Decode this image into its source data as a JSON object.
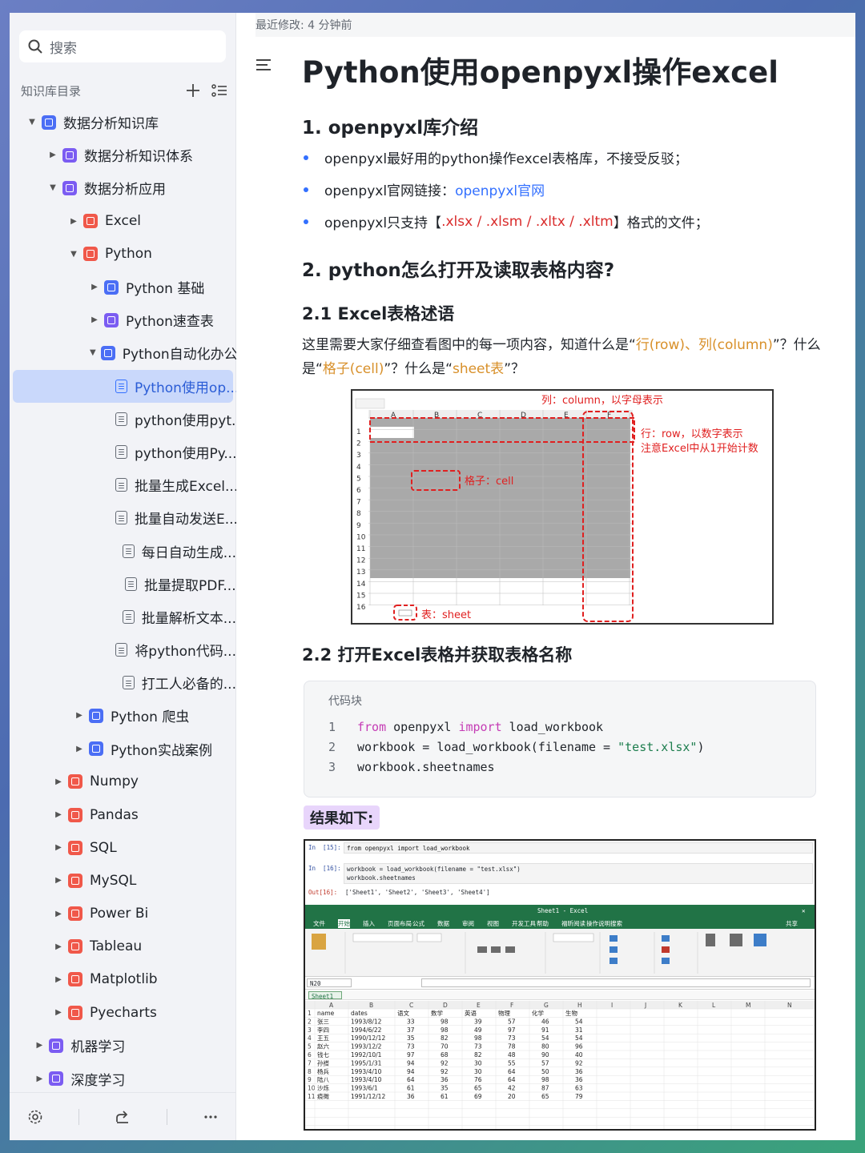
{
  "sidebar": {
    "search_placeholder": "搜索",
    "kb_title": "知识库目录",
    "tree": [
      {
        "label": "数据分析知识库",
        "level": 0,
        "caret": "down",
        "icon": "blue"
      },
      {
        "label": "数据分析知识体系",
        "level": 1,
        "caret": "right",
        "icon": "purple"
      },
      {
        "label": "数据分析应用",
        "level": 1,
        "caret": "down",
        "icon": "purple"
      },
      {
        "label": "Excel",
        "level": 2,
        "caret": "right",
        "icon": "red"
      },
      {
        "label": "Python",
        "level": 2,
        "caret": "down",
        "icon": "red"
      },
      {
        "label": "Python 基础",
        "level": 3,
        "caret": "right",
        "icon": "blue"
      },
      {
        "label": "Python速查表",
        "level": 3,
        "caret": "right",
        "icon": "purple"
      },
      {
        "label": "Python自动化办公",
        "level": 3,
        "caret": "down",
        "icon": "blue"
      },
      {
        "label": "Python使用op...",
        "level": 4,
        "caret": "none",
        "icon": "doc",
        "selected": true
      },
      {
        "label": "python使用pyt...",
        "level": 4,
        "caret": "none",
        "icon": "doc"
      },
      {
        "label": "python使用Py...",
        "level": 4,
        "caret": "none",
        "icon": "doc"
      },
      {
        "label": "批量生成Excel...",
        "level": 4,
        "caret": "none",
        "icon": "doc"
      },
      {
        "label": "批量自动发送E...",
        "level": 4,
        "caret": "none",
        "icon": "doc"
      },
      {
        "label": "每日自动生成...",
        "level": 4,
        "caret": "none",
        "icon": "doc"
      },
      {
        "label": "批量提取PDF...",
        "level": 4,
        "caret": "none",
        "icon": "doc"
      },
      {
        "label": "批量解析文本...",
        "level": 4,
        "caret": "none",
        "icon": "doc"
      },
      {
        "label": "将python代码...",
        "level": 4,
        "caret": "none",
        "icon": "doc"
      },
      {
        "label": "打工人必备的...",
        "level": 4,
        "caret": "none",
        "icon": "doc"
      },
      {
        "label": "Python 爬虫",
        "level": 2.3,
        "caret": "right",
        "icon": "blue"
      },
      {
        "label": "Python实战案例",
        "level": 2.3,
        "caret": "right",
        "icon": "blue"
      },
      {
        "label": "Numpy",
        "level": 1.3,
        "caret": "right",
        "icon": "red"
      },
      {
        "label": "Pandas",
        "level": 1.3,
        "caret": "right",
        "icon": "red"
      },
      {
        "label": "SQL",
        "level": 1.3,
        "caret": "right",
        "icon": "red"
      },
      {
        "label": "MySQL",
        "level": 1.3,
        "caret": "right",
        "icon": "red"
      },
      {
        "label": "Power Bi",
        "level": 1.3,
        "caret": "right",
        "icon": "red"
      },
      {
        "label": "Tableau",
        "level": 1.3,
        "caret": "right",
        "icon": "red"
      },
      {
        "label": "Matplotlib",
        "level": 1.3,
        "caret": "right",
        "icon": "red"
      },
      {
        "label": "Pyecharts",
        "level": 1.3,
        "caret": "right",
        "icon": "red"
      },
      {
        "label": "机器学习",
        "level": 0.4,
        "caret": "right",
        "icon": "purple"
      },
      {
        "label": "深度学习",
        "level": 0.4,
        "caret": "right",
        "icon": "purple"
      }
    ]
  },
  "doc": {
    "modified": "最近修改: 4 分钟前",
    "title": "Python使用openpyxl操作excel",
    "s1_title": "1. openpyxl库介绍",
    "b1": "openpyxl最好用的python操作excel表格库，不接受反驳；",
    "b2_prefix": "openpyxl官网链接：",
    "b2_link": "openpyxl官网",
    "b3_prefix": "openpyxl只支持【",
    "b3_red": ".xlsx / .xlsm / .xltx / .xltm",
    "b3_suffix": "】格式的文件；",
    "s2_title": "2. python怎么打开及读取表格内容?",
    "s21_title": "2.1 Excel表格述语",
    "p1": "这里需要大家仔细查看图中的每一项内容，知道什么是“",
    "p1_o1": "行(row)、列(column)",
    "p1_m": "”？什么是“",
    "p1_o2": "格子(cell)",
    "p1_m2": "”？什么是“",
    "p1_o3": "sheet表",
    "p1_end": "”？",
    "s22_title": "2.2 打开Excel表格并获取表格名称",
    "code_label": "代码块",
    "code": [
      {
        "n": "1",
        "parts": [
          [
            "kw",
            "from"
          ],
          [
            "t",
            " openpyxl "
          ],
          [
            "kw",
            "import"
          ],
          [
            "t",
            " load_workbook"
          ]
        ]
      },
      {
        "n": "2",
        "parts": [
          [
            "t",
            "workbook = load_workbook(filename = "
          ],
          [
            "str",
            "\"test.xlsx\""
          ],
          [
            "t",
            ")"
          ]
        ]
      },
      {
        "n": "3",
        "parts": [
          [
            "t",
            "workbook.sheetnames"
          ]
        ]
      }
    ],
    "result_label": "结果如下:"
  },
  "fig1": {
    "col_label": "列：column，以字母表示",
    "row_label_1": "行：row，以数字表示",
    "row_label_2": "注意Excel中从1开始计数",
    "cell_label": "格子：cell",
    "sheet_label": "表：sheet",
    "cols": [
      "A",
      "B",
      "C",
      "D",
      "E",
      "F"
    ],
    "rows": [
      "1",
      "2",
      "3",
      "4",
      "5",
      "6",
      "7",
      "8",
      "9",
      "10",
      "11",
      "12",
      "13",
      "14",
      "15",
      "16"
    ]
  },
  "fig2": {
    "in15": "In  [15]:",
    "in15_code": "from openpyxl import load_workbook",
    "in16": "In  [16]:",
    "in16_code1": "workbook = load_workbook(filename = \"test.xlsx\")",
    "in16_code2": "workbook.sheetnames",
    "out16": "Out[16]:",
    "out16_val": "['Sheet1', 'Sheet2', 'Sheet3', 'Sheet4']",
    "excel_title": "Sheet1 - Excel",
    "ribbon_tabs": [
      "文件",
      "开始",
      "插入",
      "页面布局",
      "公式",
      "数据",
      "审阅",
      "视图",
      "开发工具",
      "帮助",
      "福昕阅读",
      "操作说明搜索"
    ],
    "share": "共享",
    "namebox": "N20",
    "sheet_tab": "Sheet1",
    "col_letters": [
      "A",
      "B",
      "C",
      "D",
      "E",
      "F",
      "G",
      "H",
      "I",
      "J",
      "K",
      "L",
      "M",
      "N"
    ],
    "headers": [
      "name",
      "dates",
      "语文",
      "数学",
      "英语",
      "物理",
      "化学",
      "生物"
    ],
    "rows": [
      [
        "张三",
        "1993/8/12",
        "33",
        "98",
        "39",
        "57",
        "46",
        "54"
      ],
      [
        "李四",
        "1994/6/22",
        "37",
        "98",
        "49",
        "97",
        "91",
        "31"
      ],
      [
        "王五",
        "1990/12/12",
        "35",
        "82",
        "98",
        "73",
        "54",
        "54"
      ],
      [
        "赵六",
        "1993/12/2",
        "73",
        "70",
        "73",
        "78",
        "80",
        "96"
      ],
      [
        "钱七",
        "1992/10/1",
        "97",
        "68",
        "82",
        "48",
        "90",
        "40"
      ],
      [
        "孙搭",
        "1995/1/31",
        "94",
        "92",
        "30",
        "55",
        "57",
        "92"
      ],
      [
        "杨兵",
        "1993/4/10",
        "94",
        "92",
        "30",
        "64",
        "50",
        "36"
      ],
      [
        "陆八",
        "1993/4/10",
        "64",
        "36",
        "76",
        "64",
        "98",
        "36"
      ],
      [
        "沙烁",
        "1993/6/1",
        "61",
        "35",
        "65",
        "42",
        "87",
        "63"
      ],
      [
        "痕徵",
        "1991/12/12",
        "36",
        "61",
        "69",
        "20",
        "65",
        "79"
      ]
    ]
  },
  "colors": {
    "accent": "#3370ff",
    "selected_bg": "#c9d8fb",
    "red": "#d92b2b",
    "orange": "#d8902a",
    "excel_green": "#217346"
  }
}
